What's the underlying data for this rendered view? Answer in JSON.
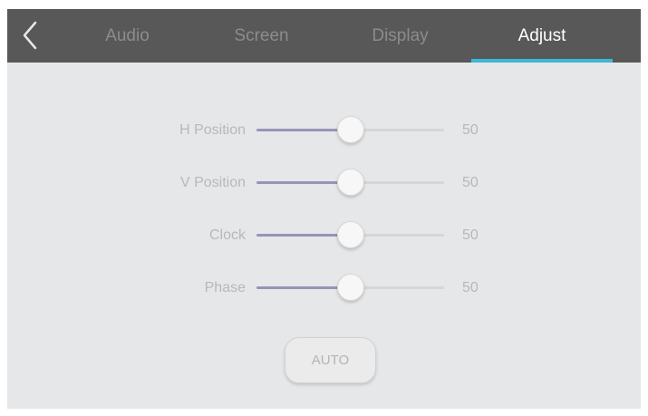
{
  "tabs": [
    {
      "label": "Audio",
      "active": false
    },
    {
      "label": "Screen",
      "active": false
    },
    {
      "label": "Display",
      "active": false
    },
    {
      "label": "Adjust",
      "active": true
    }
  ],
  "settings": [
    {
      "label": "H Position",
      "value": "50",
      "fraction": 0.5
    },
    {
      "label": "V Position",
      "value": "50",
      "fraction": 0.5
    },
    {
      "label": "Clock",
      "value": "50",
      "fraction": 0.5
    },
    {
      "label": "Phase",
      "value": "50",
      "fraction": 0.5
    }
  ],
  "auto_button": {
    "label": "AUTO"
  },
  "icons": {
    "back": "chevron-left-icon"
  },
  "colors": {
    "topbar": "#585858",
    "accent_underline": "#3fb6d8",
    "slider_fill": "#9893b7",
    "background": "#e6e7e8"
  }
}
